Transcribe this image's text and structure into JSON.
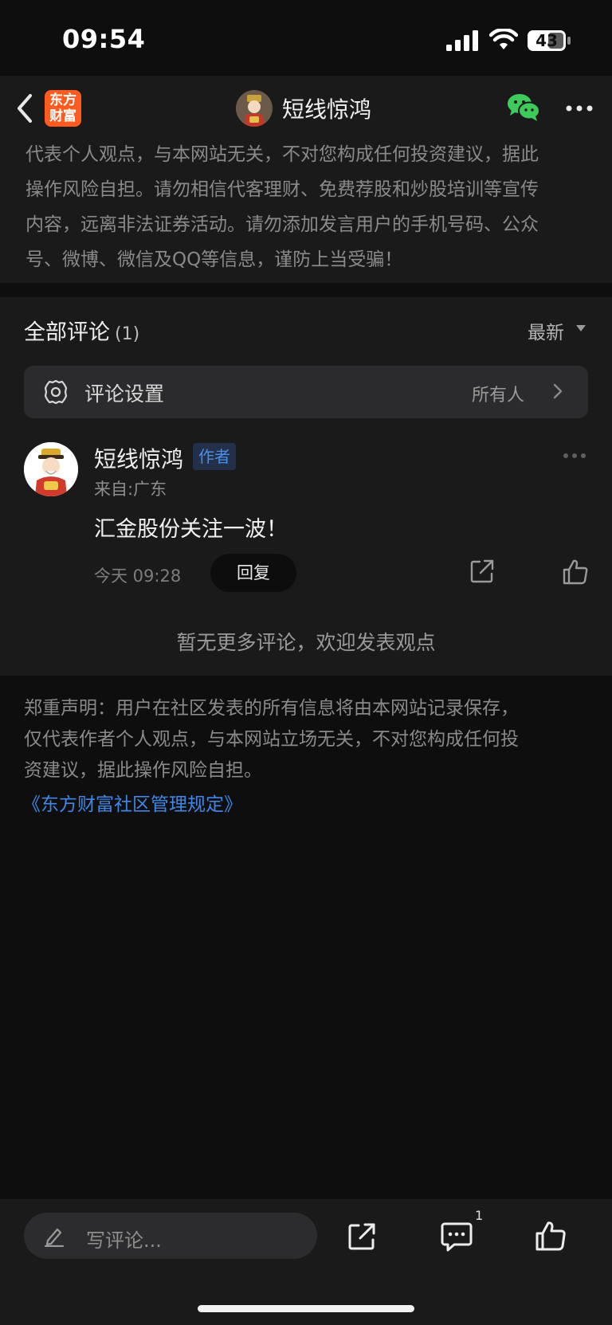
{
  "status_bar": {
    "time": "09:54",
    "battery": "43"
  },
  "nav": {
    "brand_line1": "东方",
    "brand_line2": "财富",
    "title": "短线惊鸿",
    "icons": [
      "back-icon",
      "wechat-icon",
      "more-icon"
    ]
  },
  "top_disclaimer": {
    "lines": [
      "代表个人观点，与本网站无关，不对您构成任何投资建议，据此",
      "操作风险自担。请勿相信代客理财、免费荐股和炒股培训等宣传",
      "内容，远离非法证券活动。请勿添加发言用户的手机号码、公众",
      "号、微博、微信及QQ等信息，谨防上当受骗！"
    ]
  },
  "comments": {
    "header": "全部评论",
    "count": "(1)",
    "sort": "最新",
    "settings_label": "评论设置",
    "settings_value": "所有人",
    "items": [
      {
        "user": "短线惊鸿",
        "badge": "作者",
        "location": "来自:广东",
        "text": "汇金股份关注一波！",
        "time": "今天 09:28",
        "reply_label": "回复"
      }
    ],
    "no_more": "暂无更多评论，欢迎发表观点"
  },
  "bottom_disclaimer": {
    "lines": [
      "郑重声明：用户在社区发表的所有信息将由本网站记录保存，",
      "仅代表作者个人观点，与本网站立场无关，不对您构成任何投",
      "资建议，据此操作风险自担。"
    ],
    "link": "《东方财富社区管理规定》"
  },
  "bottom_bar": {
    "input_placeholder": "写评论...",
    "comment_count": "1"
  },
  "colors": {
    "background": "#0e0e0f",
    "panel": "#1a1a1b",
    "brand": "#ff5a1f",
    "link": "#3f87e6",
    "author_badge": "#4a8fe8"
  }
}
